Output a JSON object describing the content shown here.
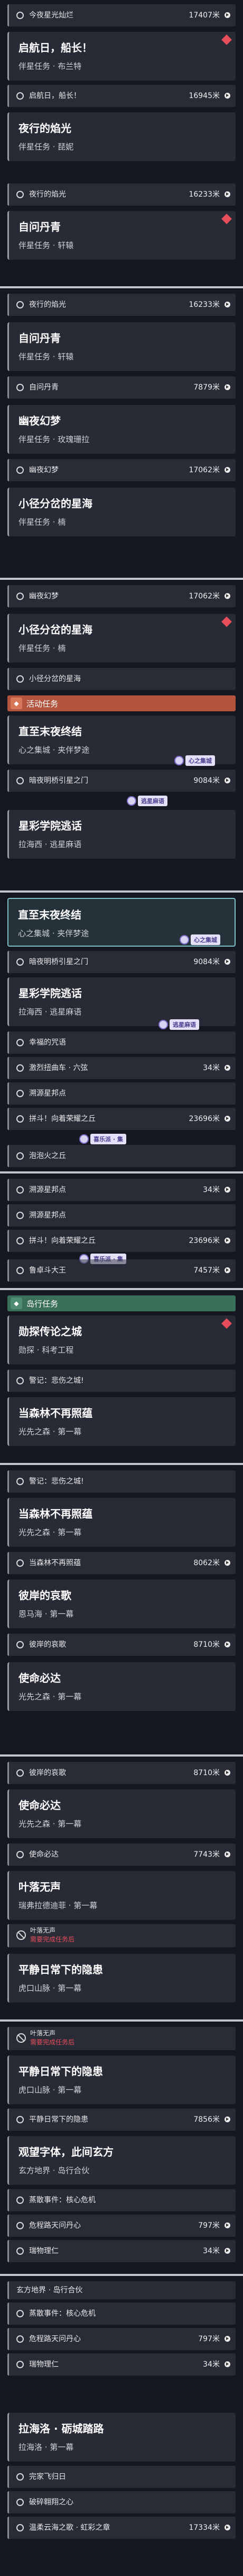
{
  "s1": {
    "r1": {
      "text": "今夜星光灿烂",
      "dist": "17407米"
    },
    "c1": {
      "title": "启航日，船长！",
      "sub": "伴星任务 · 布兰特"
    },
    "r2": {
      "text": "启航日，船长！",
      "dist": "16945米"
    },
    "c2": {
      "title": "夜行的焰光",
      "sub": "伴星任务 · 琵妮"
    },
    "r3": {
      "text": "夜行的焰光",
      "dist": "16233米"
    },
    "c3": {
      "title": "自问丹青",
      "sub": "伴星任务 · 轩辕"
    }
  },
  "s2": {
    "r1": {
      "text": "夜行的焰光",
      "dist": "16233米"
    },
    "c1": {
      "title": "自问丹青",
      "sub": "伴星任务 · 轩辕"
    },
    "r2": {
      "text": "自问丹青",
      "dist": "7879米"
    },
    "c2": {
      "title": "幽夜幻梦",
      "sub": "伴星任务 · 玫瑰珊拉"
    },
    "r3": {
      "text": "幽夜幻梦",
      "dist": "17062米"
    },
    "c3": {
      "title": "小径分岔的星海",
      "sub": "伴星任务 · 楠"
    }
  },
  "s3": {
    "r1": {
      "text": "幽夜幻梦",
      "dist": "17062米"
    },
    "c1": {
      "title": "小径分岔的星海",
      "sub": "伴星任务 · 楠"
    },
    "r2": {
      "text": "小径分岔的星海"
    },
    "hdr": "活动任务",
    "c2": {
      "title": "直至末夜终结",
      "sub": "心之集城 · 夹伴梦途"
    },
    "r3": {
      "text": "暗夜明桥引星之门",
      "dist": "9084米"
    },
    "c3": {
      "title": "星彩学院逃话",
      "sub": "拉海西 · 逃星麻语"
    },
    "m1": "心之集城",
    "m2": "逃星麻语"
  },
  "s4": {
    "c1": {
      "title": "直至末夜终结",
      "sub": "心之集城 · 夹伴梦途"
    },
    "r1": {
      "text": "暗夜明桥引星之门",
      "dist": "9084米"
    },
    "c2": {
      "title": "星彩学院逃话",
      "sub": "拉海西 · 逃星麻语"
    },
    "r2": {
      "text": "幸福的咒语"
    },
    "r3": {
      "text": "激烈扭曲车 · 六弦",
      "dist": "34米"
    },
    "r4": {
      "text": "溯源星邦点"
    },
    "r5": {
      "text": "拼斗！向着荣耀之丘",
      "dist": "23696米"
    },
    "r6": {
      "text": "泡泡火之丘"
    },
    "m1": "心之集城",
    "m2": "逃星麻语",
    "m3": "喜乐派 · 集"
  },
  "s5": {
    "r1": {
      "text": "溯源星邦点",
      "dist": "34米"
    },
    "r2": {
      "text": "溯源星邦点"
    },
    "r3": {
      "text": "拼斗！向着荣耀之丘",
      "dist": "23696米"
    },
    "r4": {
      "text": "鲁卓斗大王",
      "dist": "7457米"
    },
    "m1": "喜乐派 · 集"
  },
  "s6": {
    "hdr": "岛行任务",
    "c1": {
      "title": "勋探传论之城",
      "sub": "勋探 · 科考工程"
    },
    "r1": {
      "text": "警记：悲伤之城!"
    },
    "c2": {
      "title": "当森林不再照蕴",
      "sub": "光先之森 · 第一幕"
    }
  },
  "s7": {
    "r1": {
      "text": "警记：悲伤之城!"
    },
    "c1": {
      "title": "当森林不再照蕴",
      "sub": "光先之森 · 第一幕"
    },
    "r2": {
      "text": "当森林不再照蕴",
      "dist": "8062米"
    },
    "c2": {
      "title": "彼岸的哀歌",
      "sub": "恩马海 · 第一幕"
    },
    "r3": {
      "text": "彼岸的哀歌",
      "dist": "8710米"
    },
    "c3": {
      "title": "使命必达",
      "sub": "光先之森 · 第一幕"
    }
  },
  "s8": {
    "r1": {
      "text": "彼岸的哀歌",
      "dist": "8710米"
    },
    "c1": {
      "title": "使命必达",
      "sub": "光先之森 · 第一幕"
    },
    "r2": {
      "text": "使命必达",
      "dist": "7743米"
    },
    "c2": {
      "title": "叶落无声",
      "sub": "瑞弗拉德迪菲 · 第一幕"
    },
    "w1": {
      "a": "叶落无声",
      "b": "需要完成任务后"
    },
    "c3": {
      "title": "平静日常下的隐患",
      "sub": "虎口山脉 · 第一幕"
    }
  },
  "s9": {
    "w1": {
      "a": "叶落无声",
      "b": "需要完成任务后"
    },
    "c1": {
      "title": "平静日常下的隐患",
      "sub": "虎口山脉 · 第一幕"
    },
    "r1": {
      "text": "平静日常下的隐患",
      "dist": "7856米"
    },
    "c2": {
      "title": "观望字体，此间玄方",
      "sub": "玄方地界 · 岛行合伙"
    },
    "r2": {
      "text": "蒸散事件：核心危机"
    },
    "r3": {
      "text": "危程路天问丹心",
      "dist": "797米"
    },
    "r4": {
      "text": "瑞物理仁",
      "dist": "34米"
    }
  },
  "s10": {
    "hdr": "玄方地界 · 岛行合伙",
    "r1": {
      "text": "蒸散事件：核心危机"
    },
    "r2": {
      "text": "危程路天问丹心",
      "dist": "797米"
    },
    "r3": {
      "text": "瑞物理仁",
      "dist": "34米"
    },
    "c1": {
      "title": "拉海洛 · 砺城踏路",
      "sub": "拉海洛 · 第一幕"
    },
    "r4": {
      "text": "完家飞归日"
    },
    "r5": {
      "text": "破碎翱翔之心"
    },
    "r6": {
      "text": "温柔云海之歌 · 虹彩之章",
      "dist": "17334米"
    }
  }
}
